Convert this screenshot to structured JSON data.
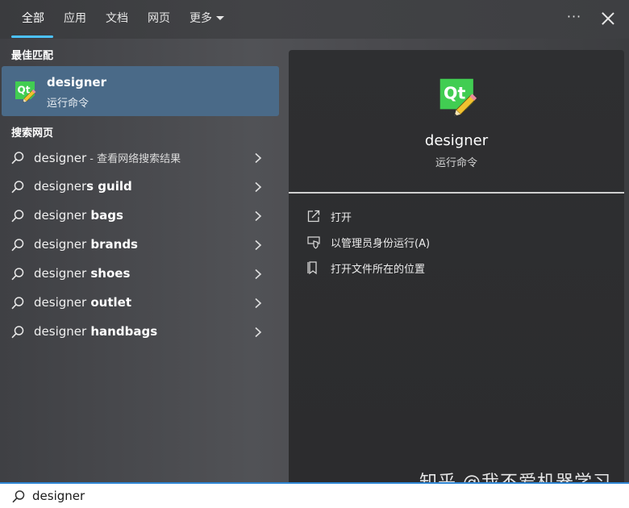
{
  "tabs": [
    {
      "label": "全部",
      "active": true
    },
    {
      "label": "应用"
    },
    {
      "label": "文档"
    },
    {
      "label": "网页"
    },
    {
      "label": "更多"
    }
  ],
  "window": {
    "more_options_glyph": "···",
    "close_icon": "close-icon"
  },
  "best_match": {
    "heading": "最佳匹配",
    "title": "designer",
    "subtitle": "运行命令",
    "icon": "qt-designer-icon"
  },
  "web_search": {
    "heading": "搜索网页",
    "results": [
      {
        "query": "designer",
        "bold": "",
        "suffix": " - 查看网络搜索结果"
      },
      {
        "query": "designer",
        "bold": "s guild",
        "suffix": ""
      },
      {
        "query": "designer",
        "bold": " bags",
        "suffix": ""
      },
      {
        "query": "designer",
        "bold": " brands",
        "suffix": ""
      },
      {
        "query": "designer",
        "bold": " shoes",
        "suffix": ""
      },
      {
        "query": "designer",
        "bold": " outlet",
        "suffix": ""
      },
      {
        "query": "designer",
        "bold": " handbags",
        "suffix": ""
      }
    ]
  },
  "detail": {
    "title": "designer",
    "subtitle": "运行命令",
    "actions": [
      {
        "label": "打开",
        "icon": "open-icon"
      },
      {
        "label": "以管理员身份运行(A)",
        "icon": "shield-icon"
      },
      {
        "label": "打开文件所在的位置",
        "icon": "folder-location-icon"
      }
    ]
  },
  "watermark": "知乎 @我不爱机器学习",
  "search": {
    "value": "designer",
    "icon": "search-icon"
  },
  "colors": {
    "accent": "#4cc2ff",
    "selection": "#4a6a88",
    "qt_green": "#41cd52"
  }
}
